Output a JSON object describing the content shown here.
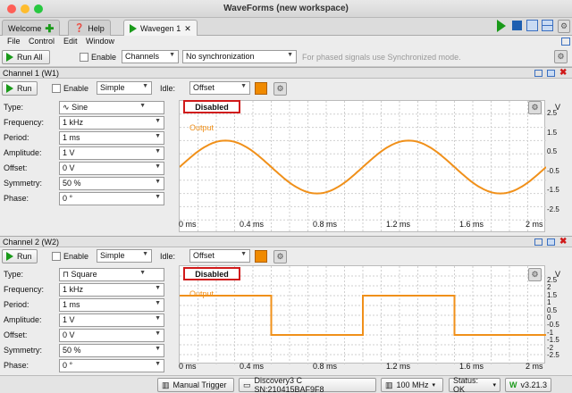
{
  "window": {
    "title": "WaveForms (new workspace)"
  },
  "tabs": [
    {
      "label": "Welcome"
    },
    {
      "label": "Help"
    },
    {
      "label": "Wavegen 1"
    }
  ],
  "menu": [
    "File",
    "Control",
    "Edit",
    "Window"
  ],
  "toolbar": {
    "run_all": "Run All",
    "enable": "Enable",
    "channels": "Channels",
    "sync": "No synchronization",
    "hint": "For phased signals use Synchronized mode."
  },
  "channels": [
    {
      "header": "Channel 1 (W1)",
      "run": "Run",
      "enable": "Enable",
      "mode": "Simple",
      "idle_label": "Idle:",
      "idle": "Offset",
      "params": [
        {
          "name": "Type:",
          "value": "Sine"
        },
        {
          "name": "Frequency:",
          "value": "1 kHz"
        },
        {
          "name": "Period:",
          "value": "1 ms"
        },
        {
          "name": "Amplitude:",
          "value": "1 V"
        },
        {
          "name": "Offset:",
          "value": "0 V"
        },
        {
          "name": "Symmetry:",
          "value": "50 %"
        },
        {
          "name": "Phase:",
          "value": "0 °"
        }
      ],
      "status": "Disabled",
      "legend": "Output",
      "unit": "V",
      "yticks": [
        "2.5",
        "1.5",
        "0.5",
        "-0.5",
        "-1.5",
        "-2.5"
      ],
      "xticks": [
        "0 ms",
        "0.4 ms",
        "0.8 ms",
        "1.2 ms",
        "1.6 ms",
        "2 ms"
      ]
    },
    {
      "header": "Channel 2 (W2)",
      "run": "Run",
      "enable": "Enable",
      "mode": "Simple",
      "idle_label": "Idle:",
      "idle": "Offset",
      "params": [
        {
          "name": "Type:",
          "value": "Square"
        },
        {
          "name": "Frequency:",
          "value": "1 kHz"
        },
        {
          "name": "Period:",
          "value": "1 ms"
        },
        {
          "name": "Amplitude:",
          "value": "1 V"
        },
        {
          "name": "Offset:",
          "value": "0 V"
        },
        {
          "name": "Symmetry:",
          "value": "50 %"
        },
        {
          "name": "Phase:",
          "value": "0 °"
        }
      ],
      "status": "Disabled",
      "legend": "Output",
      "unit": "V",
      "yticks": [
        "2.5",
        "2",
        "1.5",
        "1",
        "0.5",
        "0",
        "-0.5",
        "-1",
        "-1.5",
        "-2",
        "-2.5"
      ],
      "xticks": [
        "0 ms",
        "0.4 ms",
        "0.8 ms",
        "1.2 ms",
        "1.6 ms",
        "2 ms"
      ]
    }
  ],
  "statusbar": {
    "trigger": "Manual Trigger",
    "device": "Discovery3 C SN:210415BAF9F8",
    "freq": "100 MHz",
    "status": "Status: OK",
    "version": "v3.21.3"
  },
  "colors": {
    "trace": "#f0901a",
    "disabled_border": "#d01a1a",
    "run_green": "#1a9a1a"
  }
}
